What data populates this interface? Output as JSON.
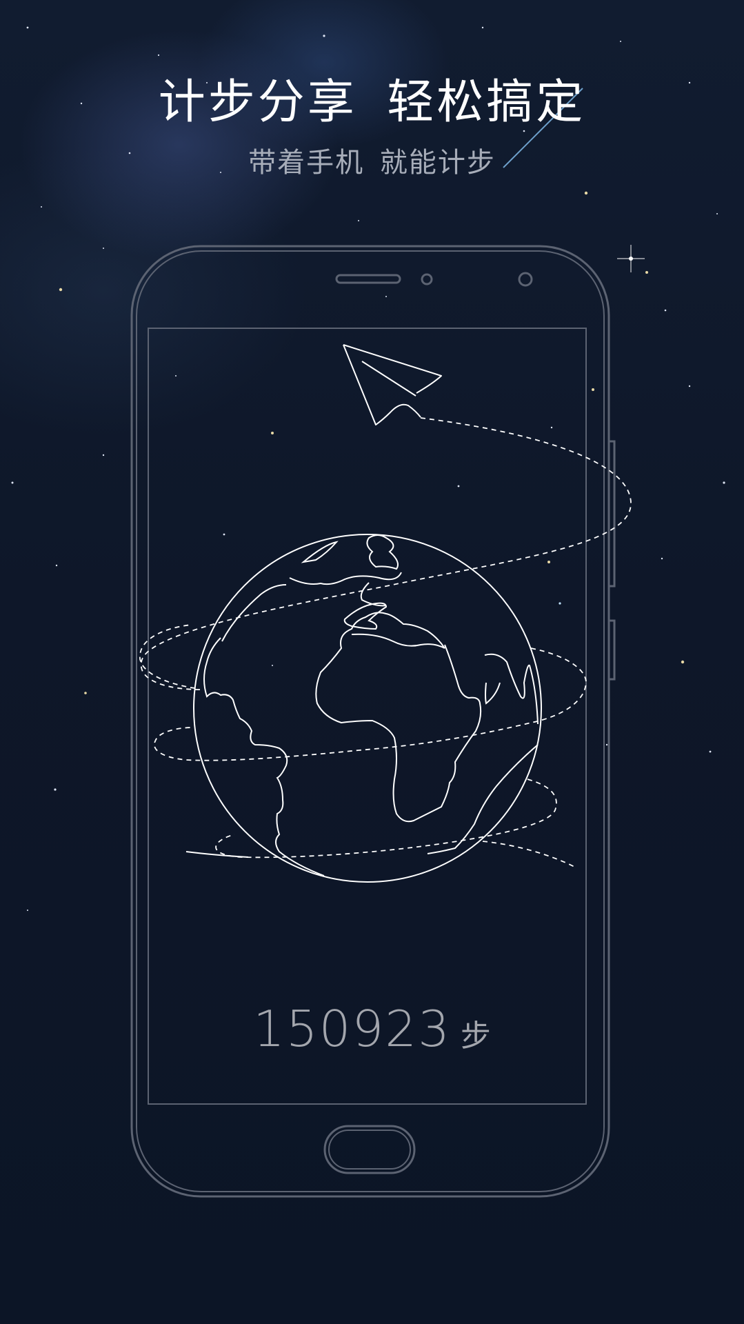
{
  "header": {
    "title": "计步分享  轻松搞定",
    "subtitle": "带着手机  就能计步"
  },
  "phone": {
    "steps_value": "150923",
    "steps_unit": "步"
  },
  "colors": {
    "background": "#0d1627",
    "title": "#ffffff",
    "subtitle": "#a7adb9",
    "outline": "#5c6372",
    "line_art": "#ffffff"
  },
  "icons": [
    "paper-plane-icon",
    "globe-icon",
    "shooting-star",
    "phone-outline"
  ]
}
